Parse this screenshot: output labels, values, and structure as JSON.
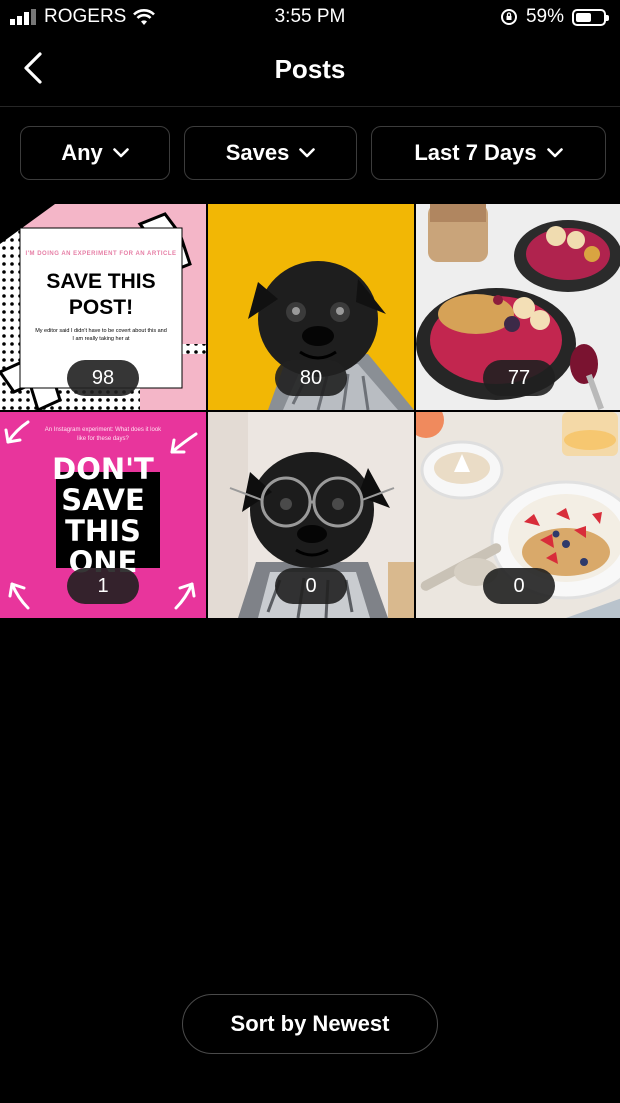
{
  "status_bar": {
    "carrier": "ROGERS",
    "time": "3:55 PM",
    "battery_percent": "59%",
    "battery_level": 0.59
  },
  "header": {
    "title": "Posts",
    "back_icon": "chevron-left-icon"
  },
  "filters": [
    {
      "label": "Any"
    },
    {
      "label": "Saves"
    },
    {
      "label": "Last 7 Days"
    }
  ],
  "posts": [
    {
      "count": "98",
      "kicker": "I'M DOING AN EXPERIMENT FOR AN ARTICLE",
      "headline_1": "SAVE THIS",
      "headline_2": "POST!",
      "body": "My editor said I didn't have to be covert about this and I am really taking her at"
    },
    {
      "count": "80"
    },
    {
      "count": "77"
    },
    {
      "count": "1",
      "kicker": "An Instagram experiment: What does it look like for these days?",
      "headline_1": "DON'T",
      "headline_2": "SAVE",
      "headline_3": "THIS",
      "headline_4": "ONE"
    },
    {
      "count": "0"
    },
    {
      "count": "0"
    }
  ],
  "sort_button": {
    "label": "Sort by Newest"
  },
  "colors": {
    "background": "#000000",
    "pink_post": "#e8359c",
    "yellow_post": "#f2b705"
  }
}
